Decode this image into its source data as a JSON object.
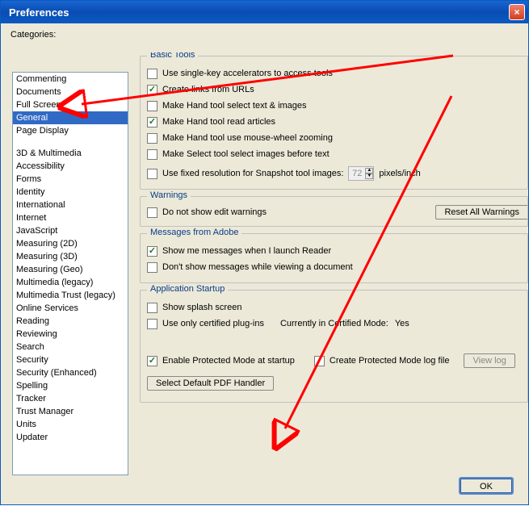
{
  "title": "Preferences",
  "sidebar": {
    "label": "Categories:",
    "items": [
      "Commenting",
      "Documents",
      "Full Screen",
      "General",
      "Page Display",
      "",
      "3D & Multimedia",
      "Accessibility",
      "Forms",
      "Identity",
      "International",
      "Internet",
      "JavaScript",
      "Measuring (2D)",
      "Measuring (3D)",
      "Measuring (Geo)",
      "Multimedia (legacy)",
      "Multimedia Trust (legacy)",
      "Online Services",
      "Reading",
      "Reviewing",
      "Search",
      "Security",
      "Security (Enhanced)",
      "Spelling",
      "Tracker",
      "Trust Manager",
      "Units",
      "Updater"
    ],
    "selected": "General"
  },
  "groups": {
    "basic": {
      "legend": "Basic Tools",
      "opts": [
        {
          "label": "Use single-key accelerators to access tools",
          "checked": false,
          "u": "s"
        },
        {
          "label": "Create links from URLs",
          "checked": true,
          "u": "l"
        },
        {
          "label": "Make Hand tool select text & images",
          "checked": false,
          "u": ""
        },
        {
          "label": "Make Hand tool read articles",
          "checked": true,
          "u": "a"
        },
        {
          "label": "Make Hand tool use mouse-wheel zooming",
          "checked": false,
          "u": "z"
        },
        {
          "label": "Make Select tool select images before text",
          "checked": false,
          "u": ""
        }
      ],
      "fixed": {
        "label": "Use fixed resolution for Snapshot tool images:",
        "checked": false,
        "value": "72",
        "unit": "pixels/inch"
      }
    },
    "warnings": {
      "legend": "Warnings",
      "opts": [
        {
          "label": "Do not show edit warnings",
          "checked": false,
          "u": "e"
        }
      ],
      "reset": "Reset All Warnings"
    },
    "messages": {
      "legend": "Messages from Adobe",
      "opts": [
        {
          "label": "Show me messages when I launch Reader",
          "checked": true,
          "u": ""
        },
        {
          "label": "Don't show messages while viewing a document",
          "checked": false,
          "u": "D"
        }
      ]
    },
    "startup": {
      "legend": "Application Startup",
      "opts": [
        {
          "label": "Show splash screen",
          "checked": false,
          "u": ""
        },
        {
          "label": "Use only certified plug-ins",
          "checked": false,
          "u": "c"
        }
      ],
      "cert_label": "Currently in Certified Mode:",
      "cert_value": "Yes",
      "protected": {
        "label": "Enable Protected Mode at startup",
        "checked": true,
        "u": "M"
      },
      "logfile": {
        "label": "Create Protected Mode log file",
        "checked": false
      },
      "viewlog": "View log",
      "select_handler": "Select Default PDF Handler"
    }
  },
  "ok": "OK"
}
